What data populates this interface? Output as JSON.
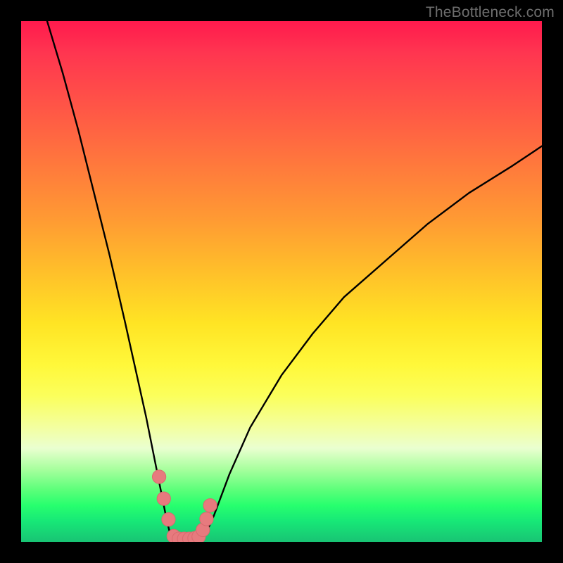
{
  "watermark": "TheBottleneck.com",
  "colors": {
    "frame": "#000000",
    "curve": "#000000",
    "marker_fill": "#e77a7e",
    "marker_stroke": "#d96a6e",
    "gradient_top": "#ff1a4d",
    "gradient_bottom": "#18c474"
  },
  "chart_data": {
    "type": "line",
    "title": "",
    "xlabel": "",
    "ylabel": "",
    "xlim": [
      0,
      100
    ],
    "ylim": [
      0,
      100
    ],
    "grid": false,
    "legend": false,
    "description": "Bottleneck-percentage style curve: steep left branch dropping from ~100 to 0 near x≈29, flat near-zero trough from x≈29 to x≈35, then rising right branch toward ~75 at x=100. Salmon-colored round markers cluster along the trough and the base of both branches.",
    "series": [
      {
        "name": "left_branch",
        "x": [
          5,
          8,
          11,
          14,
          17,
          20,
          22,
          24,
          25,
          26,
          27,
          28,
          29
        ],
        "y": [
          100,
          90,
          79,
          67,
          55,
          42,
          33,
          24,
          19,
          14,
          9,
          4,
          0
        ]
      },
      {
        "name": "trough",
        "x": [
          29,
          30,
          31,
          32,
          33,
          34,
          35
        ],
        "y": [
          0,
          0,
          0,
          0,
          0,
          0,
          0.5
        ]
      },
      {
        "name": "right_branch",
        "x": [
          35,
          37,
          40,
          44,
          50,
          56,
          62,
          70,
          78,
          86,
          94,
          100
        ],
        "y": [
          0.5,
          5,
          13,
          22,
          32,
          40,
          47,
          54,
          61,
          67,
          72,
          76
        ]
      }
    ],
    "markers": {
      "name": "trough_markers",
      "x": [
        26.5,
        27.4,
        28.3,
        29.3,
        30.3,
        31.3,
        32.3,
        33.3,
        34.1,
        34.9,
        35.6,
        36.3
      ],
      "y": [
        12.5,
        8.3,
        4.3,
        1.1,
        0.6,
        0.6,
        0.6,
        0.7,
        1.0,
        2.3,
        4.4,
        7.0
      ],
      "r": 1.3
    }
  }
}
